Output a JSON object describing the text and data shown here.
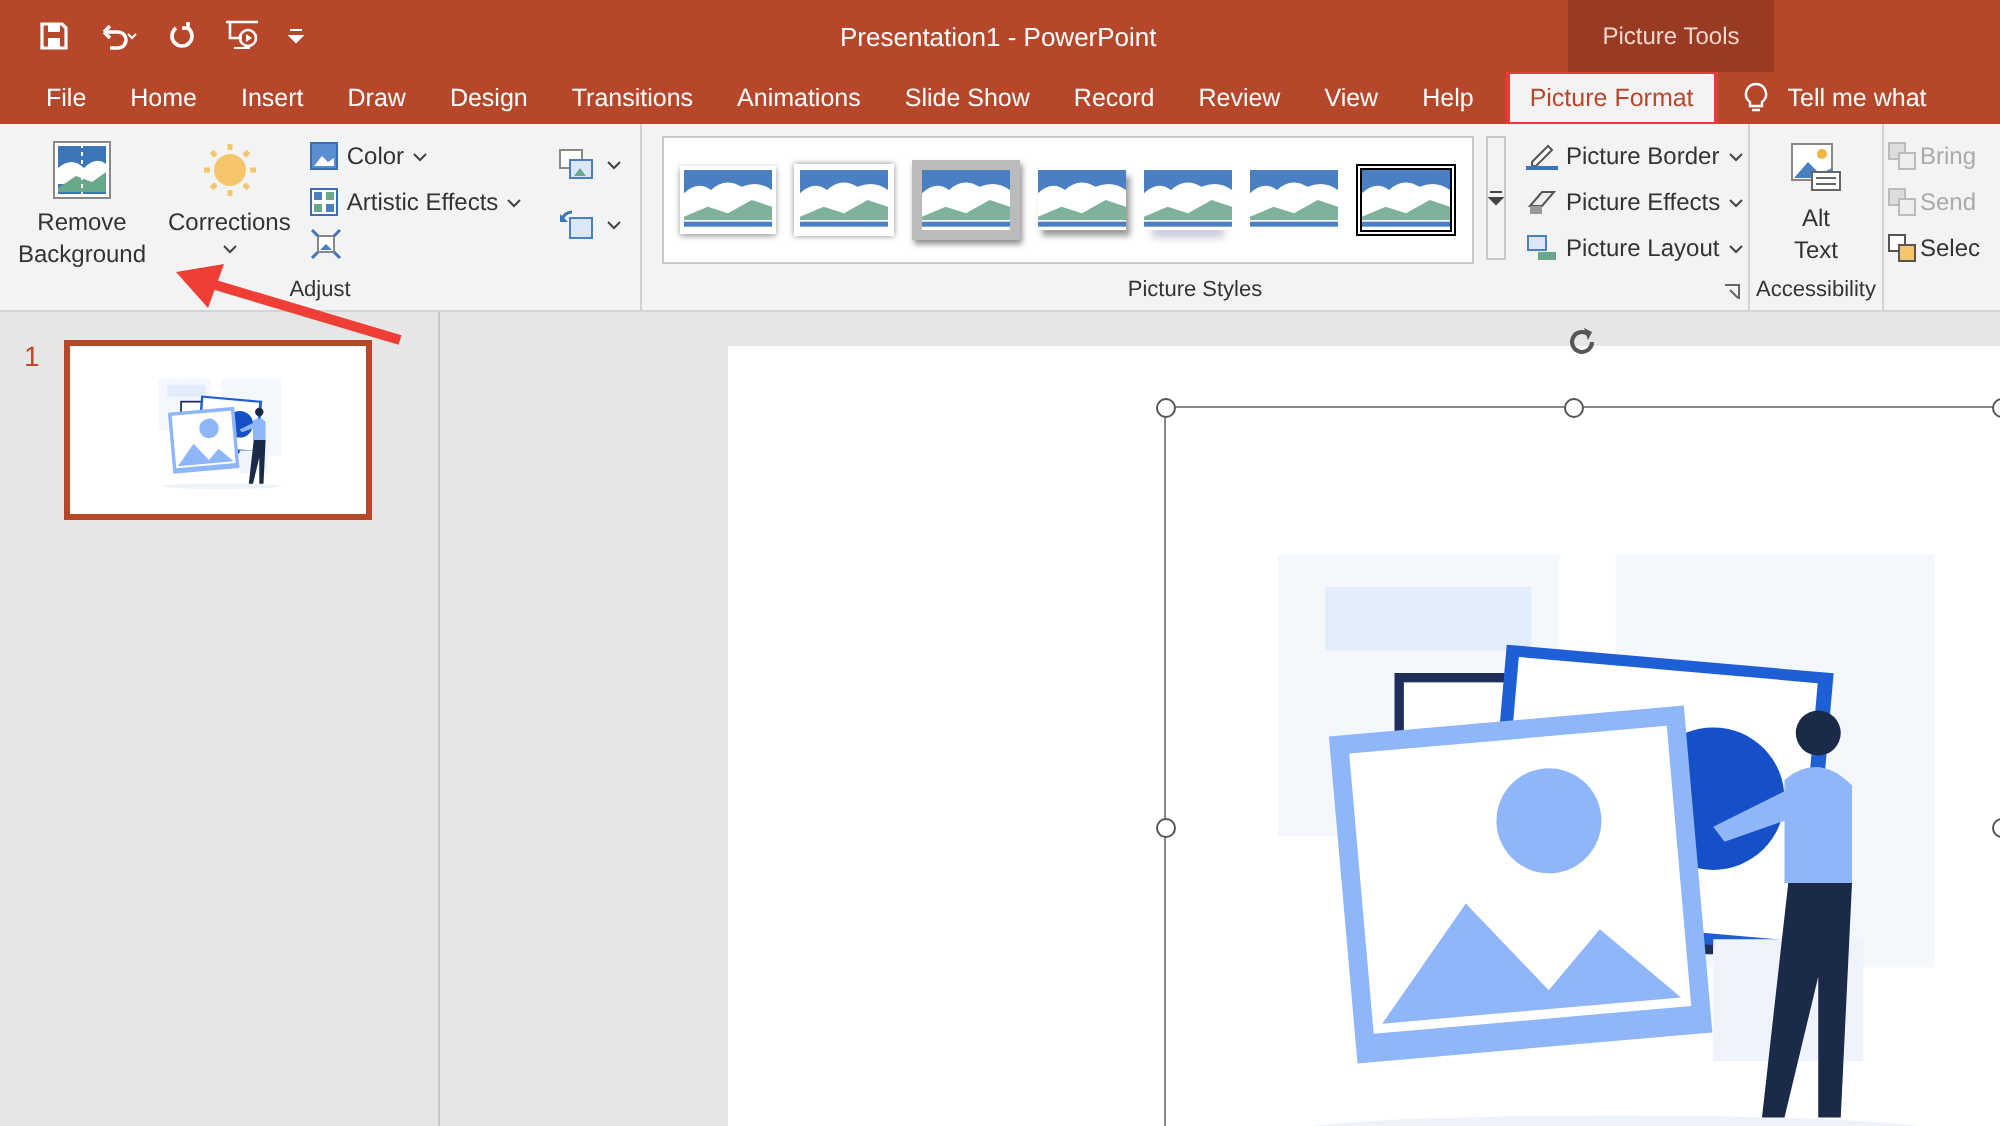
{
  "window": {
    "title": "Presentation1  -  PowerPoint",
    "context_label": "Picture Tools"
  },
  "tabs": [
    {
      "label": "File",
      "selected": false,
      "highlighted": false
    },
    {
      "label": "Home",
      "selected": false,
      "highlighted": false
    },
    {
      "label": "Insert",
      "selected": false,
      "highlighted": false
    },
    {
      "label": "Draw",
      "selected": false,
      "highlighted": false
    },
    {
      "label": "Design",
      "selected": false,
      "highlighted": false
    },
    {
      "label": "Transitions",
      "selected": false,
      "highlighted": false
    },
    {
      "label": "Animations",
      "selected": false,
      "highlighted": false
    },
    {
      "label": "Slide Show",
      "selected": false,
      "highlighted": false
    },
    {
      "label": "Record",
      "selected": false,
      "highlighted": false
    },
    {
      "label": "Review",
      "selected": false,
      "highlighted": false
    },
    {
      "label": "View",
      "selected": false,
      "highlighted": false
    },
    {
      "label": "Help",
      "selected": false,
      "highlighted": false
    },
    {
      "label": "Picture Format",
      "selected": true,
      "highlighted": true
    }
  ],
  "tell_me": "Tell me what",
  "adjust": {
    "remove_background": "Remove Background",
    "corrections": "Corrections",
    "color_label": "Color",
    "artistic_effects": "Artistic Effects",
    "label": "Adjust"
  },
  "picture_styles": {
    "styles": [
      {
        "kind": "simple-frame"
      },
      {
        "kind": "soft-frame"
      },
      {
        "kind": "thick-grey"
      },
      {
        "kind": "shadow"
      },
      {
        "kind": "reflected"
      },
      {
        "kind": "soft-edge"
      },
      {
        "kind": "black-frame"
      }
    ],
    "commands": [
      "Picture Border",
      "Picture Effects",
      "Picture Layout"
    ],
    "label": "Picture Styles"
  },
  "accessibility": {
    "alt_text": "Alt Text",
    "label": "Accessibility"
  },
  "arrange": [
    {
      "label": "Bring",
      "disabled": true
    },
    {
      "label": "Send",
      "disabled": true
    },
    {
      "label": "Selec",
      "disabled": false
    }
  ],
  "slides": [
    {
      "number": "1",
      "selected": true
    }
  ]
}
